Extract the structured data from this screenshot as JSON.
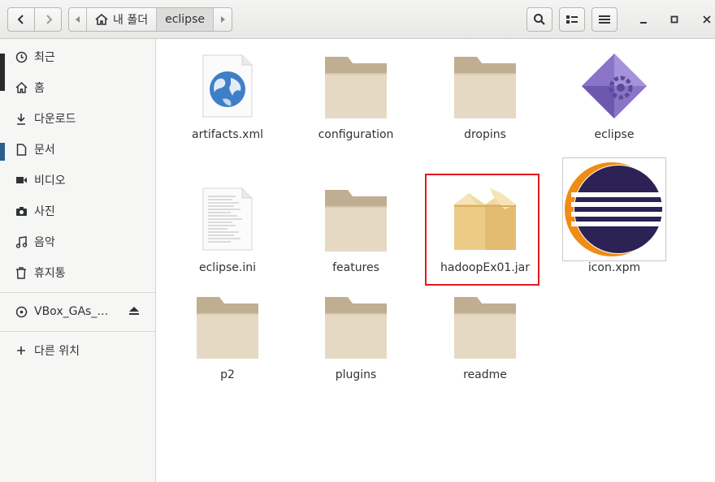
{
  "header": {
    "path": {
      "home_label": "내 폴더",
      "current_label": "eclipse"
    }
  },
  "sidebar": {
    "items": [
      {
        "label": "최근",
        "icon": "clock-icon"
      },
      {
        "label": "홈",
        "icon": "home-icon"
      },
      {
        "label": "다운로드",
        "icon": "download-icon"
      },
      {
        "label": "문서",
        "icon": "document-icon"
      },
      {
        "label": "비디오",
        "icon": "video-icon"
      },
      {
        "label": "사진",
        "icon": "camera-icon"
      },
      {
        "label": "음악",
        "icon": "music-icon"
      },
      {
        "label": "휴지통",
        "icon": "trash-icon"
      }
    ],
    "device": {
      "label": "VBox_GAs_…",
      "icon": "disc-icon"
    },
    "other": {
      "label": "다른 위치",
      "icon": "plus-icon"
    }
  },
  "files": [
    {
      "name": "artifacts.xml",
      "type": "xml"
    },
    {
      "name": "configuration",
      "type": "folder"
    },
    {
      "name": "dropins",
      "type": "folder"
    },
    {
      "name": "eclipse",
      "type": "executable"
    },
    {
      "name": "eclipse.ini",
      "type": "text"
    },
    {
      "name": "features",
      "type": "folder"
    },
    {
      "name": "hadoopEx01.jar",
      "type": "jar"
    },
    {
      "name": "icon.xpm",
      "type": "image"
    },
    {
      "name": "p2",
      "type": "folder"
    },
    {
      "name": "plugins",
      "type": "folder"
    },
    {
      "name": "readme",
      "type": "folder"
    }
  ],
  "colors": {
    "folder": "#d9c9ad",
    "folder_tab": "#bfae91",
    "selection": "#e0191f"
  }
}
